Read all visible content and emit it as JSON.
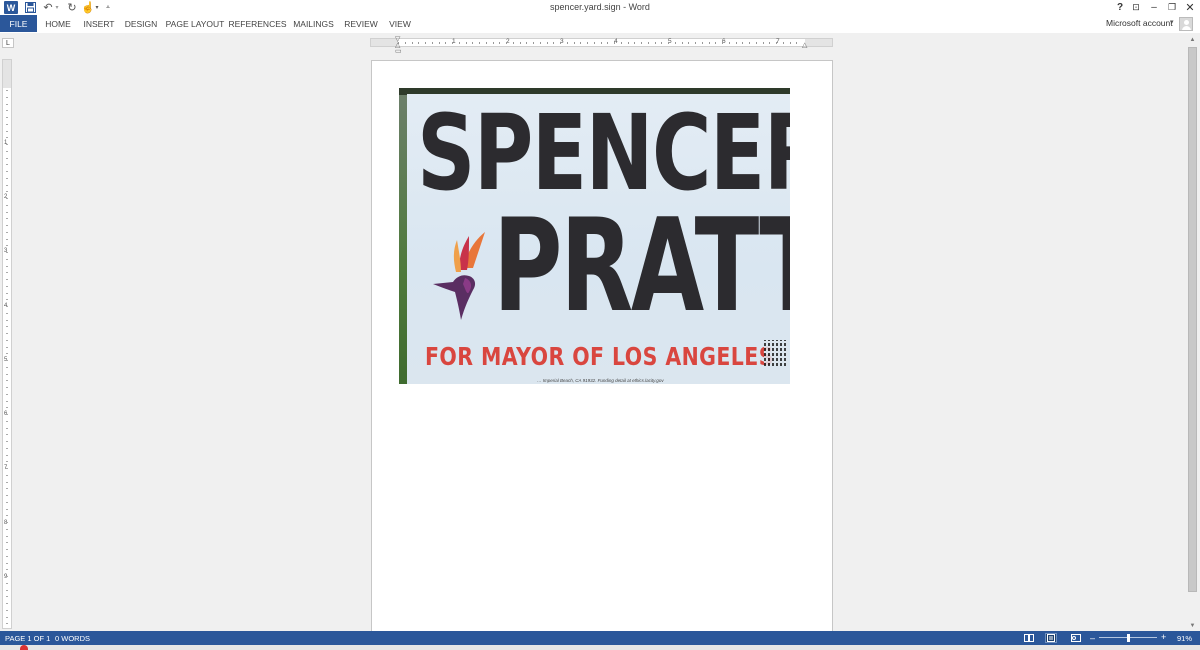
{
  "window": {
    "title": "spencer.yard.sign - Word",
    "app_icon": "word-app-icon",
    "controls": {
      "help": "?",
      "ribbon_display": "⊡",
      "minimize": "–",
      "restore": "❐",
      "close": "✕"
    }
  },
  "quick_access": {
    "save_icon": "save-icon",
    "undo_icon": "undo-icon",
    "redo_icon": "redo-icon",
    "touch_mode_icon": "touch-mode-icon"
  },
  "ribbon": {
    "tabs": [
      "FILE",
      "HOME",
      "INSERT",
      "DESIGN",
      "PAGE LAYOUT",
      "REFERENCES",
      "MAILINGS",
      "REVIEW",
      "VIEW"
    ],
    "active_tab": "FILE",
    "account_label": "Microsoft account"
  },
  "ruler": {
    "corner_label": "L",
    "horizontal_numbers": [
      "1",
      "2",
      "3",
      "4",
      "5",
      "6",
      "7"
    ],
    "vertical_numbers": [
      "1",
      "2",
      "3",
      "4",
      "5",
      "6",
      "7",
      "8",
      "9"
    ]
  },
  "document": {
    "image": {
      "headline_first": "SPENCER",
      "headline_last": "PRATT",
      "tagline": "FOR MAYOR OF LOS ANGELES",
      "disclaimer": "… Imperial Beach, CA 91932. Funding detail at ethics.lacity.gov"
    }
  },
  "status_bar": {
    "page_count": "PAGE 1 OF 1",
    "word_count": "0 WORDS",
    "zoom_level": "91%",
    "zoom_out": "–",
    "zoom_in": "+",
    "zoom_fraction": 0.5
  },
  "colors": {
    "accent": "#2b579a",
    "sign_text": "#2c2b2f",
    "sign_red": "#d9463f"
  }
}
